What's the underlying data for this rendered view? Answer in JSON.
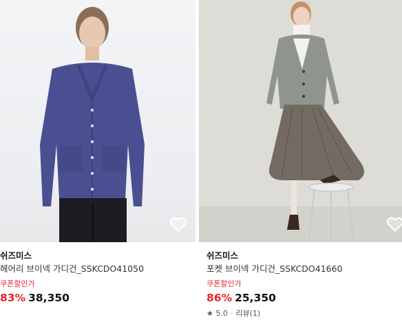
{
  "products": [
    {
      "brand": "쉬즈미스",
      "name": "헤어리 브이넥 가디건_SSKCDO41050",
      "coupon_label": "쿠폰할인가",
      "discount": "83%",
      "price": "38,350",
      "cardigan_color": "#4a4f92",
      "wishlist_icon": "heart-outline-icon"
    },
    {
      "brand": "쉬즈미스",
      "name": "포켓 브이넥 가디건_SSKCDO41660",
      "coupon_label": "쿠폰할인가",
      "discount": "86%",
      "price": "25,350",
      "rating": "5.0",
      "review_label": "리뷰(1)",
      "cardigan_color": "#8f958e",
      "wishlist_icon": "heart-outline-icon"
    }
  ],
  "colors": {
    "sale_red": "#e8252b",
    "text_dark": "#111111"
  }
}
